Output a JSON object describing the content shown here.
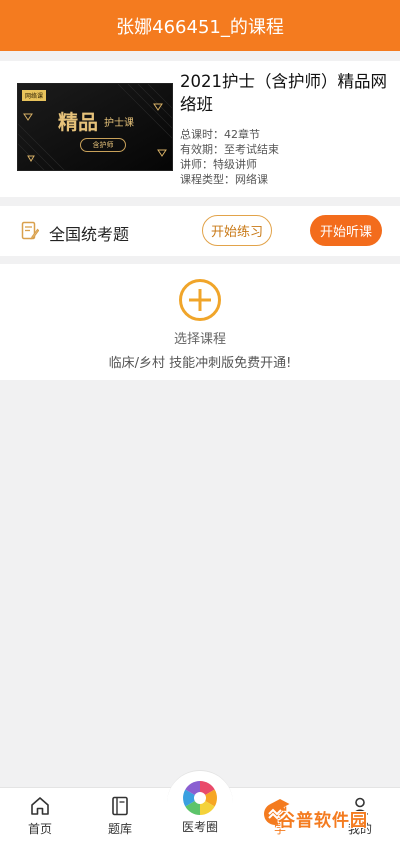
{
  "header": {
    "title": "张娜466451_的课程"
  },
  "course": {
    "thumb": {
      "tag": "网络课",
      "big_text": "精品",
      "small_text": "护士课",
      "badge": "含护师"
    },
    "title": "2021护士（含护师）精品网络班",
    "meta": [
      "总课时：42章节",
      "有效期：至考试结束",
      "讲师：特级讲师",
      "课程类型：网络课"
    ]
  },
  "exam": {
    "title": "全国统考题",
    "practice_label": "开始练习",
    "listen_label": "开始听课",
    "icon": "edit-icon"
  },
  "select_course": {
    "label": "选择课程",
    "promo": "临床/乡村 技能冲刺版免费开通!",
    "icon": "plus-circle-icon"
  },
  "nav": {
    "home": "首页",
    "question_bank": "题库",
    "center": "医考圈",
    "study": "学",
    "mine": "我的"
  },
  "watermark": "谷普软件园",
  "colors": {
    "accent": "#f47b1f",
    "button_orange": "#f36c1c",
    "practice_border": "#e2a34a",
    "gold": "#e6c27a"
  }
}
